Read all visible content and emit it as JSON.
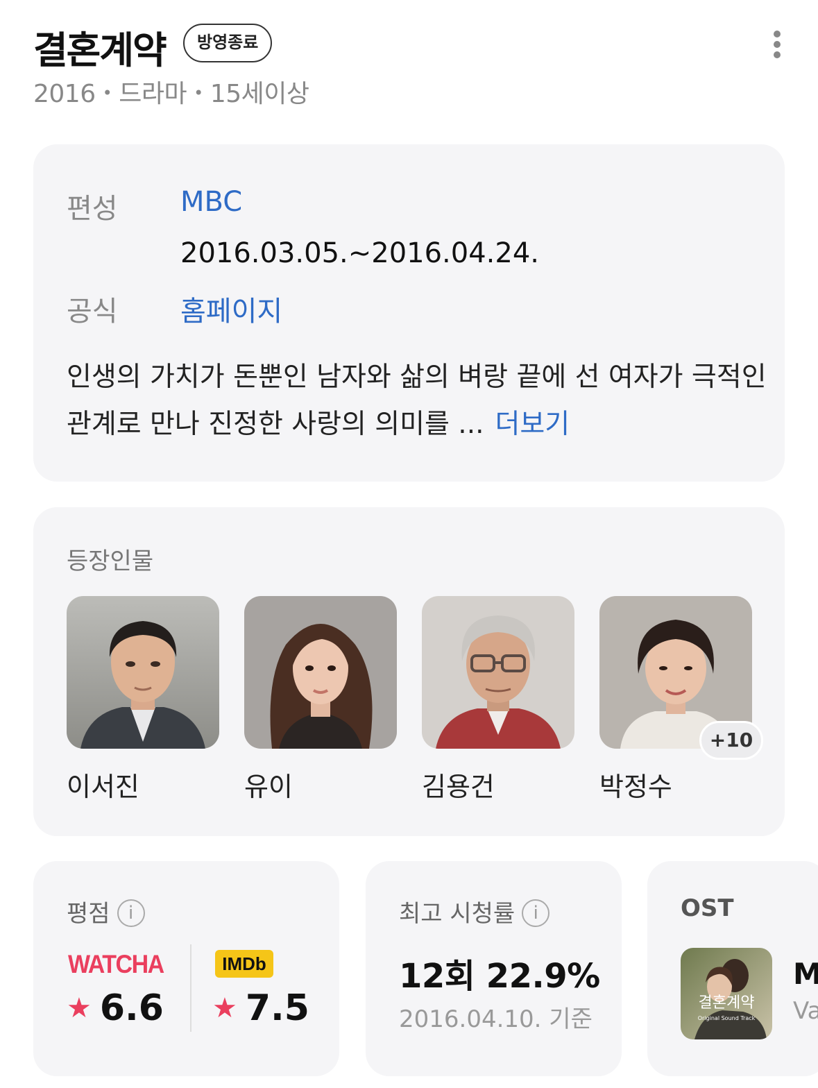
{
  "header": {
    "title": "결혼계약",
    "badge": "방영종료",
    "year": "2016",
    "genre": "드라마",
    "rating_age": "15세이상"
  },
  "info": {
    "broadcast_label": "편성",
    "broadcast_value": "MBC",
    "period": "2016.03.05.~2016.04.24.",
    "official_label": "공식",
    "official_value": "홈페이지",
    "description": "인생의 가치가 돈뿐인 남자와 삶의 벼랑 끝에 선 여자가 극적인 관계로 만나 진정한 사랑의 의미를 ...",
    "more_label": "더보기"
  },
  "cast": {
    "title": "등장인물",
    "members": [
      {
        "name": "이서진"
      },
      {
        "name": "유이"
      },
      {
        "name": "김용건"
      },
      {
        "name": "박정수"
      }
    ],
    "extra_count": "+10"
  },
  "rating": {
    "title": "평점",
    "info_icon": "i",
    "watcha_logo": "WATCHA",
    "watcha_score": "6.6",
    "imdb_logo": "IMDb",
    "imdb_score": "7.5"
  },
  "viewership": {
    "title": "최고 시청률",
    "info_icon": "i",
    "value": "12회 22.9%",
    "date": "2016.04.10. 기준"
  },
  "ost": {
    "title": "OST",
    "song_title_partial": "M",
    "artist_partial": "Va"
  },
  "colors": {
    "accent_link": "#2e6bc6",
    "watcha": "#ea3f5e",
    "imdb": "#f5c518",
    "card_bg": "#f5f5f7"
  }
}
